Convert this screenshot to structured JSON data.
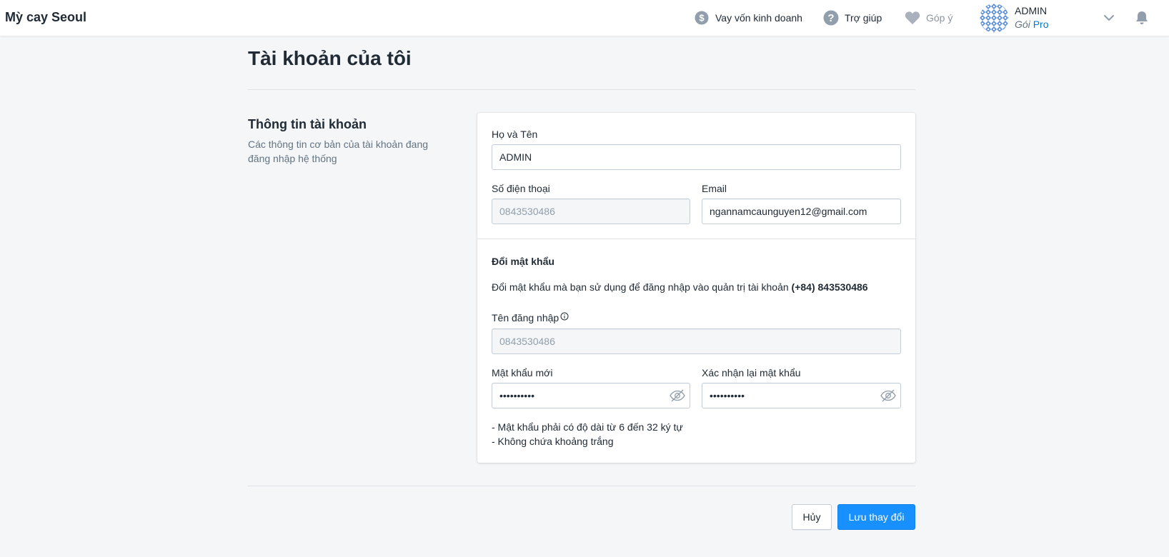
{
  "header": {
    "brand": "Mỳ cay Seoul",
    "nav": {
      "loan": "Vay vốn kinh doanh",
      "help": "Trợ giúp",
      "feedback": "Góp ý"
    },
    "user": {
      "name": "ADMIN",
      "plan_prefix": "Gói",
      "plan_name": "Pro"
    },
    "icons": [
      "dollar-icon",
      "help-icon",
      "heart-icon",
      "chevron-down-icon",
      "bell-icon"
    ]
  },
  "page": {
    "title": "Tài khoản của tôi"
  },
  "account_section": {
    "title": "Thông tin tài khoản",
    "description": "Các thông tin cơ bản của tài khoản đang đăng nhập hệ thống"
  },
  "form": {
    "full_name_label": "Họ và Tên",
    "full_name_value": "ADMIN",
    "phone_label": "Số điện thoại",
    "phone_value": "0843530486",
    "email_label": "Email",
    "email_value": "ngannamcaunguyen12@gmail.com"
  },
  "password_section": {
    "title": "Đổi mật khẩu",
    "description_prefix": "Đổi mật khẩu mà bạn sử dụng để đăng nhập vào quản trị tài khoản",
    "account_phone": "(+84) 843530486",
    "username_label": "Tên đăng nhập",
    "username_value": "0843530486",
    "new_password_label": "Mật khẩu mới",
    "new_password_value": "••••••••••",
    "confirm_password_label": "Xác nhận lại mật khẩu",
    "confirm_password_value": "••••••••••",
    "hint_1": "- Mật khẩu phải có độ dài từ 6 đến 32 ký tự",
    "hint_2": "- Không chứa khoảng trắng"
  },
  "actions": {
    "cancel": "Hủy",
    "save": "Lưu thay đổi"
  },
  "colors": {
    "primary": "#1890ff",
    "pro": "#007ace",
    "background": "#f4f6f8"
  }
}
